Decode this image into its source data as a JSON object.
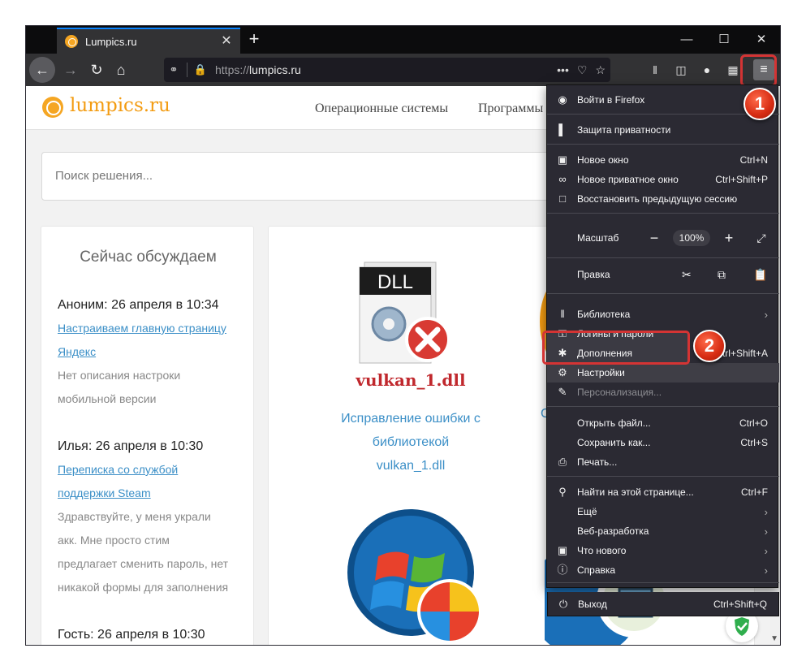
{
  "browser": {
    "tab_title": "Lumpics.ru",
    "tab_close": "✕",
    "new_tab": "+",
    "win_min": "—",
    "win_max": "☐",
    "win_close": "✕",
    "url_scheme": "https://",
    "url_host": "lumpics.ru",
    "url_more": "•••",
    "menu_button": "≡"
  },
  "site": {
    "logo_text": "lumpics.ru",
    "nav": [
      "Операционные системы",
      "Программы"
    ],
    "search_placeholder": "Поиск решения..."
  },
  "sidebar": {
    "title": "Сейчас обсуждаем",
    "entries": [
      {
        "author": "Аноним: 26 апреля в 10:34",
        "link_1": "Настраиваем главную страницу",
        "link_2": "Яндекс",
        "desc_1": "Нет описания настроки",
        "desc_2": "мобильной версии"
      },
      {
        "author": "Илья: 26 апреля в 10:30",
        "link_1": "Переписка со службой",
        "link_2": "поддержки Steam",
        "desc_1": "Здравствуйте, у меня украли",
        "desc_2": "акк. Мне просто стим",
        "desc_3": "предлагает сменить пароль, нет",
        "desc_4": "никакой формы для заполнения"
      },
      {
        "author": "Гость: 26 апреля в 10:30"
      }
    ]
  },
  "articles": {
    "dll_label": "DLL",
    "dll_name": "vulkan_1.dll",
    "link_1": "Исправление ошибки с",
    "link_2": "библиотекой",
    "link_3": "vulkan_1.dll",
    "second_link_fragment": "С"
  },
  "app_menu": {
    "items": [
      {
        "label": "Войти в Firefox",
        "icon": "account-icon"
      },
      {
        "label": "Защита приватности",
        "icon": "protections-icon"
      },
      {
        "label": "Новое окно",
        "key": "Ctrl+N",
        "icon": "new-window-icon"
      },
      {
        "label": "Новое приватное окно",
        "key": "Ctrl+Shift+P",
        "icon": "private-mask-icon"
      },
      {
        "label": "Восстановить предыдущую сессию",
        "icon": "restore-session-icon"
      },
      {
        "label": "Масштаб",
        "zoom": "100%"
      },
      {
        "label": "Правка"
      },
      {
        "label": "Библиотека",
        "icon": "library-icon"
      },
      {
        "label": "Логины и пароли",
        "icon": "key-icon"
      },
      {
        "label": "Дополнения",
        "key": "Ctrl+Shift+A",
        "icon": "addons-icon"
      },
      {
        "label": "Настройки",
        "icon": "gear-icon"
      },
      {
        "label": "Персонализация...",
        "icon": "customize-icon"
      },
      {
        "label": "Открыть файл...",
        "key": "Ctrl+O"
      },
      {
        "label": "Сохранить как...",
        "key": "Ctrl+S"
      },
      {
        "label": "Печать...",
        "icon": "print-icon"
      },
      {
        "label": "Найти на этой странице...",
        "key": "Ctrl+F",
        "icon": "search-icon"
      },
      {
        "label": "Ещё"
      },
      {
        "label": "Веб-разработка"
      },
      {
        "label": "Что нового",
        "icon": "gift-icon"
      },
      {
        "label": "Справка",
        "icon": "help-icon"
      },
      {
        "label": "Выход",
        "key": "Ctrl+Shift+Q",
        "icon": "power-icon"
      }
    ]
  },
  "annotations": {
    "step_1": "1",
    "step_2": "2",
    "highlight_color": "#d43434"
  }
}
